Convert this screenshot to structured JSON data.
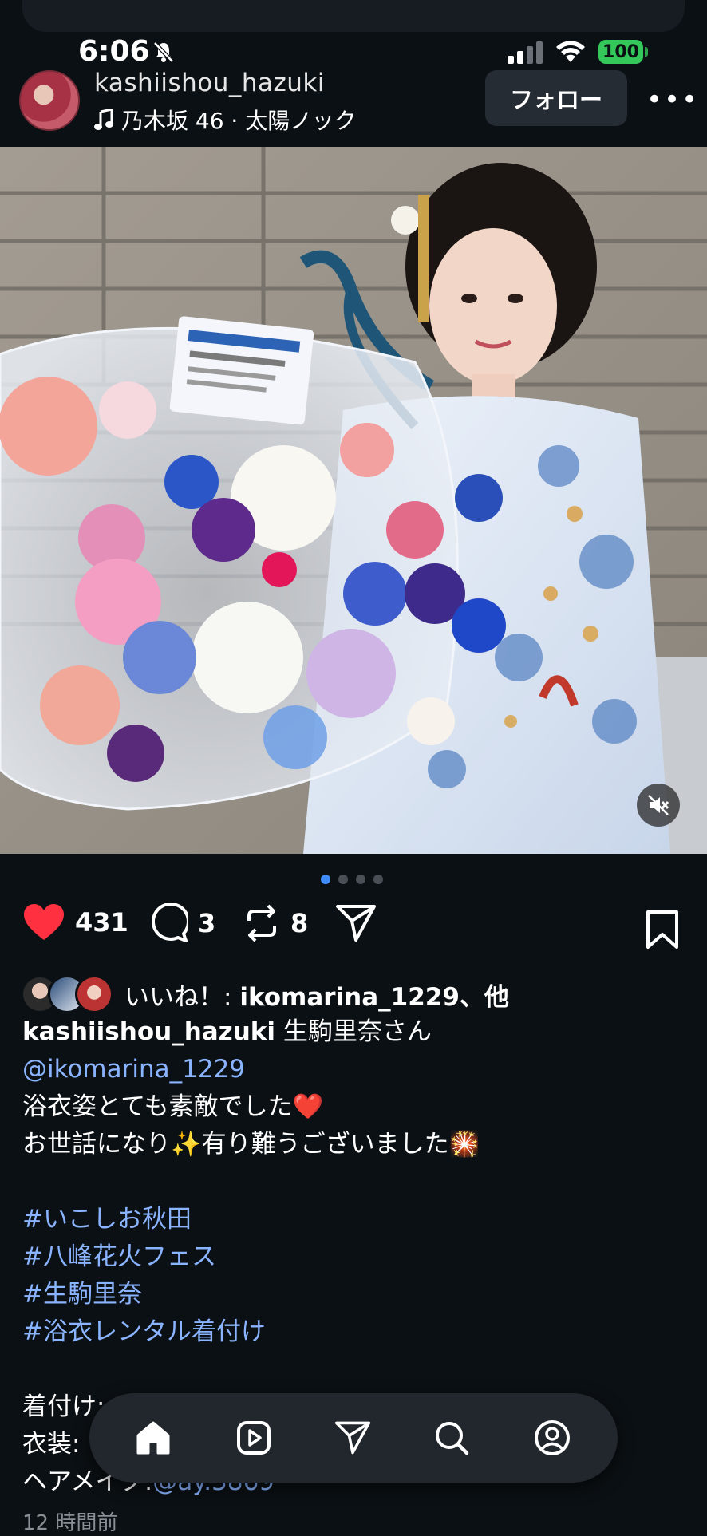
{
  "status_bar": {
    "time": "6:06",
    "battery": "100"
  },
  "header": {
    "username": "kashiishou_hazuki",
    "music": "乃木坂 46 · 太陽ノック",
    "follow_label": "フォロー",
    "more_label": "•••"
  },
  "carousel": {
    "total": 4,
    "active": 1
  },
  "actions": {
    "likes": "431",
    "comments": "3",
    "reposts": "8"
  },
  "liked_by": {
    "prefix": "いいね！: ",
    "user": "ikomarina_1229",
    "suffix": "、他"
  },
  "caption": {
    "author": "kashiishou_hazuki",
    "text1": " 生駒里奈さん",
    "mention": "@ikomarina_1229",
    "line2": "浴衣姿とても素敵でした❤️",
    "line3": "お世話になり✨有り難うございました🎇",
    "tags": [
      "#いこしお秋田",
      "#八峰花火フェス",
      "#生駒里奈",
      "#浴衣レンタル着付け"
    ],
    "line_kitsuke": "着付け:",
    "line_isho": "衣装:",
    "line_hair_label": "ヘアメイク:",
    "line_hair_handle": "@ay.3869"
  },
  "time_ago": "12 時間前",
  "colors": {
    "like": "#ff3040",
    "link": "#8ab4ff",
    "bg": "#0b1014"
  },
  "nav_icons": [
    "home-icon",
    "reels-icon",
    "send-icon",
    "search-icon",
    "profile-icon"
  ]
}
